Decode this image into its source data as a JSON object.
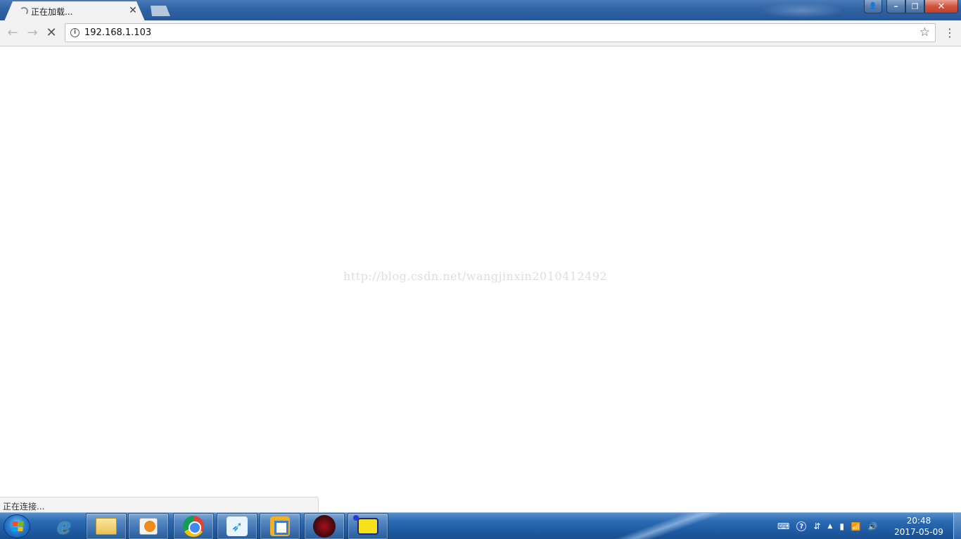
{
  "browser": {
    "tab": {
      "title": "正在加载...",
      "close_icon": "close-icon",
      "loading_icon": "spinner-icon"
    },
    "window_controls": {
      "profile": "👤",
      "minimize": "━",
      "restore": "❐",
      "close": "✕"
    },
    "toolbar": {
      "back": "←",
      "forward": "→",
      "stop": "✕",
      "info": "i",
      "url": "192.168.1.103",
      "bookmark": "☆",
      "menu": "⋮"
    },
    "watermark": "http://blog.csdn.net/wangjinxin2010412492",
    "status_text": "正在连接..."
  },
  "taskbar": {
    "apps": [
      {
        "name": "internet-explorer",
        "icon": "ie-icon",
        "glyph": "e"
      },
      {
        "name": "file-explorer",
        "icon": "folder-icon"
      },
      {
        "name": "media-player",
        "icon": "media-player-icon"
      },
      {
        "name": "chrome",
        "icon": "chrome-icon"
      },
      {
        "name": "messenger",
        "icon": "bird-icon",
        "glyph": "➶"
      },
      {
        "name": "vmware",
        "icon": "vm-icon"
      },
      {
        "name": "red-app",
        "icon": "red-circle-icon"
      },
      {
        "name": "yellow-app",
        "icon": "yellow-app-icon"
      }
    ],
    "tray": {
      "keyboard": "⌨",
      "help": "?",
      "network_switch": "⇵",
      "show_hidden": "▲",
      "battery": "▮",
      "signal": "📶",
      "volume": "🔊"
    },
    "clock": {
      "time": "20:48",
      "date": "2017-05-09"
    }
  },
  "colors": {
    "titlebar": "#2f62a3",
    "taskbar": "#1e5aa2",
    "close_button": "#c4412a"
  }
}
